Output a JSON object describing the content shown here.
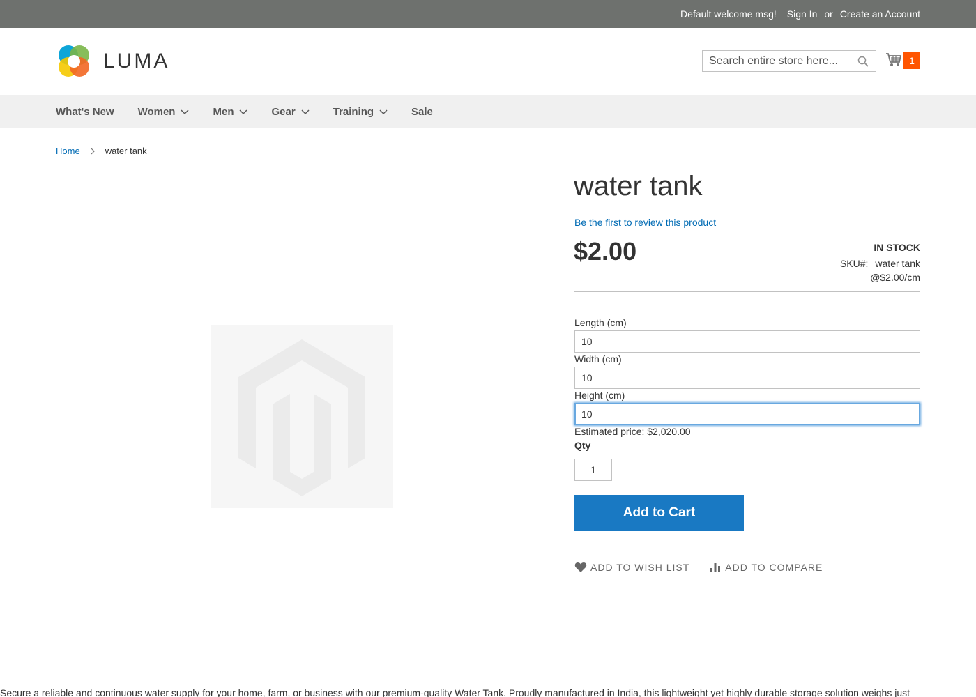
{
  "topbar": {
    "welcome": "Default welcome msg!",
    "sign_in": "Sign In",
    "or": "or",
    "create_account": "Create an Account",
    "bg_color": "#6e716e"
  },
  "header": {
    "logo_text": "LUMA",
    "search_placeholder": "Search entire store here...",
    "cart_count": "1",
    "cart_badge_color": "#ff5501"
  },
  "nav": {
    "items": [
      {
        "label": "What's New",
        "dropdown": false
      },
      {
        "label": "Women",
        "dropdown": true
      },
      {
        "label": "Men",
        "dropdown": true
      },
      {
        "label": "Gear",
        "dropdown": true
      },
      {
        "label": "Training",
        "dropdown": true
      },
      {
        "label": "Sale",
        "dropdown": false
      }
    ]
  },
  "breadcrumb": {
    "home": "Home",
    "current": "water tank"
  },
  "product": {
    "title": "water tank",
    "review_link": "Be the first to review this product",
    "price": "$2.00",
    "stock": "In stock",
    "sku_label": "SKU#:",
    "sku": "water tank",
    "unit_price": "@$2.00/cm",
    "length_label": "Length (cm)",
    "length_value": "10",
    "width_label": "Width (cm)",
    "width_value": "10",
    "height_label": "Height (cm)",
    "height_value": "10",
    "estimate": "Estimated price: $2,020.00",
    "qty_label": "Qty",
    "qty_value": "1",
    "add_to_cart": "Add to Cart",
    "wishlist": "Add to Wish List",
    "compare": "Add to Compare",
    "description": "Secure a reliable and continuous water supply for your home, farm, or business with our premium-quality Water Tank. Proudly manufactured in India, this lightweight yet highly durable storage solution weighs just"
  },
  "colors": {
    "link": "#006bb4",
    "primary_button": "#1979c3",
    "focus": "#68a8e0"
  }
}
